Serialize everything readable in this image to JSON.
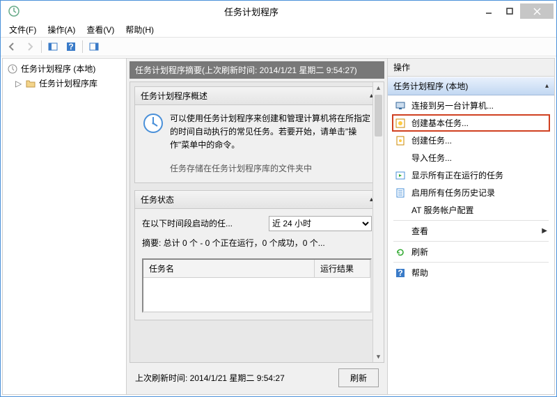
{
  "window": {
    "title": "任务计划程序"
  },
  "menu": {
    "file": "文件(F)",
    "action": "操作(A)",
    "view": "查看(V)",
    "help": "帮助(H)"
  },
  "tree": {
    "root": "任务计划程序 (本地)",
    "library": "任务计划程序库"
  },
  "center": {
    "summary": "任务计划程序摘要(上次刷新时间: 2014/1/21 星期二 9:54:27)",
    "overview_title": "任务计划程序概述",
    "overview_text": "可以使用任务计划程序来创建和管理计算机将在所指定的时间自动执行的常见任务。若要开始，请单击\"操作\"菜单中的命令。",
    "overview_cut": "任务存储在任务计划程序库的文件夹中",
    "status_title": "任务状态",
    "status_label": "在以下时间段启动的任...",
    "status_period": "近 24 小时",
    "status_summary": "摘要: 总计 0 个 - 0 个正在运行，0 个成功，0 个...",
    "col_name": "任务名",
    "col_result": "运行结果",
    "last_refresh": "上次刷新时间: 2014/1/21 星期二 9:54:27",
    "refresh_btn": "刷新"
  },
  "right": {
    "header": "操作",
    "group": "任务计划程序 (本地)",
    "actions": {
      "connect": "连接到另一台计算机...",
      "create_basic": "创建基本任务...",
      "create_task": "创建任务...",
      "import": "导入任务...",
      "show_running": "显示所有正在运行的任务",
      "enable_history": "启用所有任务历史记录",
      "at_account": "AT 服务帐户配置",
      "view": "查看",
      "refresh": "刷新",
      "help": "帮助"
    }
  }
}
